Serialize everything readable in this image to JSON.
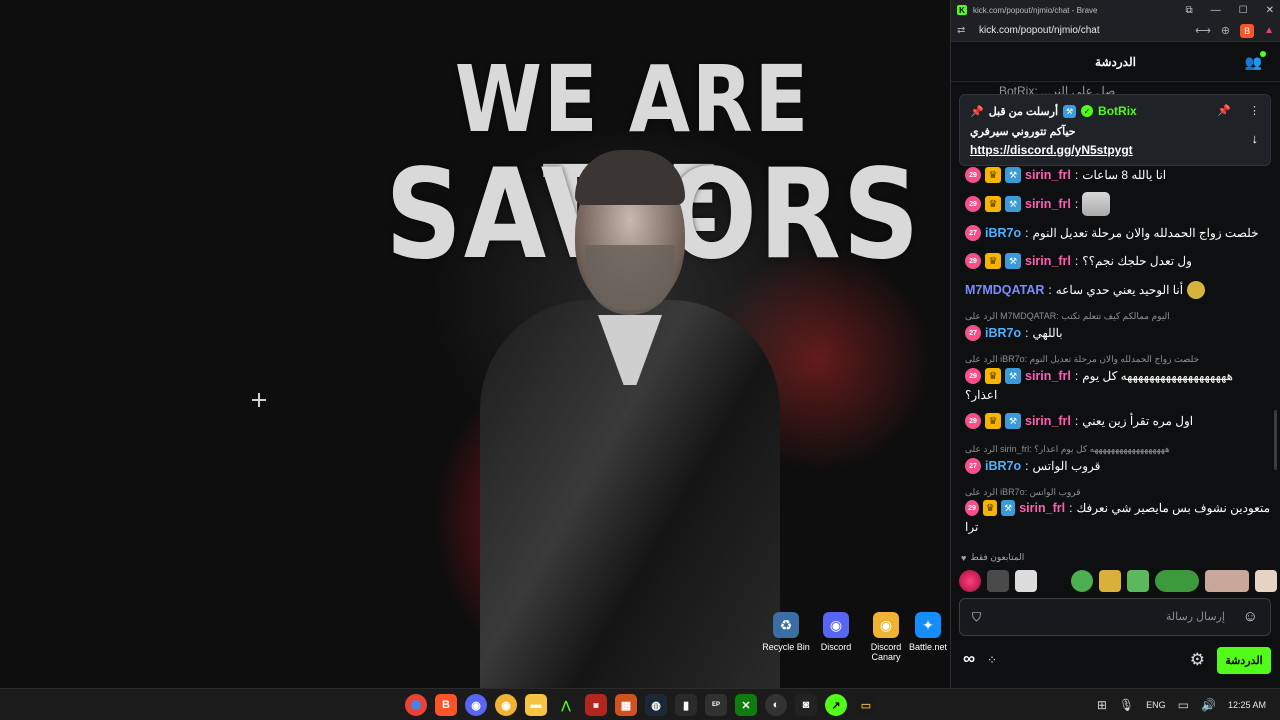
{
  "wallpaper": {
    "line1": "WE ARE THE",
    "line2": "SAVIORS"
  },
  "desktop_icons": [
    {
      "label": "Recycle Bin",
      "icon": "recycle-bin-icon",
      "color": "#3a6ea5"
    },
    {
      "label": "Discord",
      "icon": "discord-icon",
      "color": "#5865f2"
    },
    {
      "label": "Discord Canary",
      "icon": "discord-canary-icon",
      "color": "#f0b232"
    },
    {
      "label": "Battle.net",
      "icon": "battlenet-icon",
      "color": "#148eff"
    }
  ],
  "browser": {
    "title": "kick.com/popout/njmio/chat - Brave",
    "url": "kick.com/popout/njmio/chat"
  },
  "chat": {
    "title": "الدردشة",
    "faded_top": "BotRix: ...صل على النر",
    "pinned": {
      "sent_by_label": "أرسلت من قبل",
      "name": "BotRix",
      "text": "حيآكم تتوروني سيرفري",
      "link": "https://discord.gg/yN5stpygt"
    },
    "messages": [
      {
        "badge": "29",
        "user": "sirin_frl",
        "text": "انا يالله 8 ساعات"
      },
      {
        "badge": "29",
        "user": "sirin_frl",
        "text": ""
      },
      {
        "badge": "27",
        "user": "iBR7o",
        "text": "خلصت زواج الحمدلله والان مرحلة تعديل النوم"
      },
      {
        "badge": "29",
        "user": "sirin_frl",
        "text": "ول تعدل حلجك نجم؟؟"
      },
      {
        "badge": "",
        "user": "M7MDQATAR",
        "text": "أنا الوحيد يعني حدي ساعه"
      },
      {
        "reply": "الرد على M7MDQATAR: اليوم ممالكم كيف تتعلم تكتب",
        "badge": "27",
        "user": "iBR7o",
        "text": "باللهي"
      },
      {
        "reply": "الرد على iBR7o: خلصت زواج الحمدلله والان مرحلة تعديل النوم",
        "badge": "29",
        "user": "sirin_frl",
        "text": "هههههههههههههههههههه كل يوم",
        "cont": "اعذار؟"
      },
      {
        "badge": "29",
        "user": "sirin_frl",
        "text": "اول مره تقرأ زين يعني"
      },
      {
        "reply": "الرد على sirin_frl: ههههههههههههههههههه كل يوم اعذار؟",
        "badge": "27",
        "user": "iBR7o",
        "text": "قروب الواتس"
      },
      {
        "reply": "الرد على iBR7o: قروب الواتس",
        "badge": "29",
        "user": "sirin_frl",
        "text": "متعودين نشوف بس مايصير شي نعرفك",
        "cont": "ترا"
      }
    ],
    "emote_label": "المتابعون فقط",
    "input_placeholder": "إرسال رسالة",
    "send_label": "الدردشة"
  },
  "taskbar": {
    "lang": "ENG",
    "time": "12:25 AM"
  }
}
